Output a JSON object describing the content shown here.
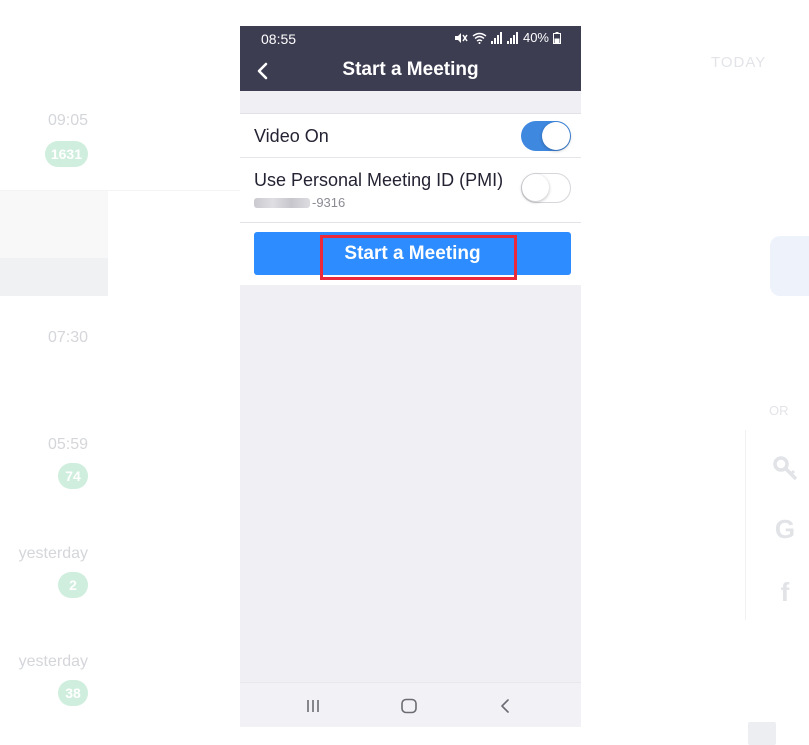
{
  "status_bar": {
    "time": "08:55",
    "battery": "40%"
  },
  "header": {
    "title": "Start a Meeting"
  },
  "settings": {
    "video": {
      "label": "Video On",
      "enabled": true
    },
    "pmi": {
      "label": "Use Personal Meeting ID (PMI)",
      "id_suffix": "-9316",
      "enabled": false
    }
  },
  "actions": {
    "start_label": "Start a Meeting"
  },
  "background": {
    "chats": [
      {
        "time": "09:05",
        "badge": "1631"
      },
      {
        "time": "07:30",
        "badge": ""
      },
      {
        "time": "05:59",
        "badge": "74"
      },
      {
        "time": "yesterday",
        "badge": "2"
      },
      {
        "time": "yesterday",
        "badge": "38"
      }
    ],
    "today_label": "TODAY",
    "or_label": "OR"
  },
  "colors": {
    "header_bg": "#3d3d52",
    "accent_blue": "#2d8cff",
    "toggle_on": "#3e88e0",
    "annotation_red": "#ea2a3a"
  }
}
